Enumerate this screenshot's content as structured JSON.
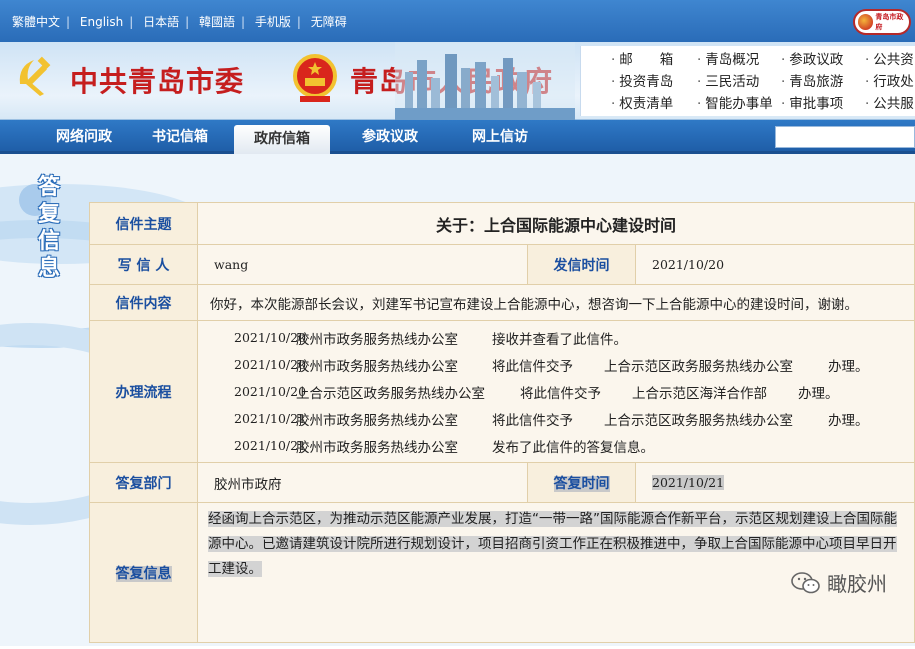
{
  "langbar": {
    "links": [
      "繁體中文",
      "English",
      "日本語",
      "韓國語",
      "手机版",
      "无障碍"
    ],
    "badge_text": "青岛市政府"
  },
  "banner": {
    "party_title": "中共青岛市委",
    "gov_title": "青岛市人民政府",
    "quick_links": [
      "邮　　箱",
      "青岛概况",
      "参政议政",
      "公共资",
      "投资青岛",
      "三民活动",
      "青岛旅游",
      "行政处",
      "权责清单",
      "智能办事单",
      "审批事项",
      "公共服"
    ]
  },
  "nav": {
    "tabs": [
      "网络问政",
      "书记信箱",
      "政府信箱",
      "参政议政",
      "网上信访"
    ],
    "active_index": 2
  },
  "side_title": "答复信息",
  "letter": {
    "subject_label": "信件主题",
    "subject": "关于：上合国际能源中心建设时间",
    "writer_label": "写 信 人",
    "writer": "wang",
    "sent_label": "发信时间",
    "sent_date": "2021/10/20",
    "content_label": "信件内容",
    "content": "你好，本次能源部长会议，刘建军书记宣布建设上合能源中心，想咨询一下上合能源中心的建设时间，谢谢。",
    "flow_label": "办理流程",
    "flow": [
      {
        "date": "2021/10/20",
        "org": "胶州市政务服务热线办公室",
        "action": "接收并查看了此信件。",
        "target": "",
        "suffix": ""
      },
      {
        "date": "2021/10/20",
        "org": "胶州市政务服务热线办公室",
        "action": "将此信件交予",
        "target": "上合示范区政务服务热线办公室",
        "suffix": "办理。"
      },
      {
        "date": "2021/10/20",
        "org": "上合示范区政务服务热线办公室",
        "action": "将此信件交予",
        "target": "上合示范区海洋合作部",
        "suffix": "办理。"
      },
      {
        "date": "2021/10/21",
        "org": "胶州市政务服务热线办公室",
        "action": "将此信件交予",
        "target": "上合示范区政务服务热线办公室",
        "suffix": "办理。"
      },
      {
        "date": "2021/10/21",
        "org": "胶州市政务服务热线办公室",
        "action": "发布了此信件的答复信息。",
        "target": "",
        "suffix": ""
      }
    ],
    "dept_label": "答复部门",
    "dept": "胶州市政府",
    "reply_time_label": "答复时间",
    "reply_date": "2021/10/21",
    "reply_label": "答复信息",
    "reply": "经函询上合示范区，为推动示范区能源产业发展，打造“一带一路”国际能源合作新平台，示范区规划建设上合国际能源中心。已邀请建筑设计院所进行规划设计，项目招商引资工作正在积极推进中，争取上合国际能源中心项目早日开工建设。"
  },
  "watermark": "瞰胶州",
  "colors": {
    "accent_blue": "#2a6cb8",
    "title_red": "#c51e1e",
    "label_blue": "#1b4fa0",
    "table_bg": "#fbf6ed"
  }
}
